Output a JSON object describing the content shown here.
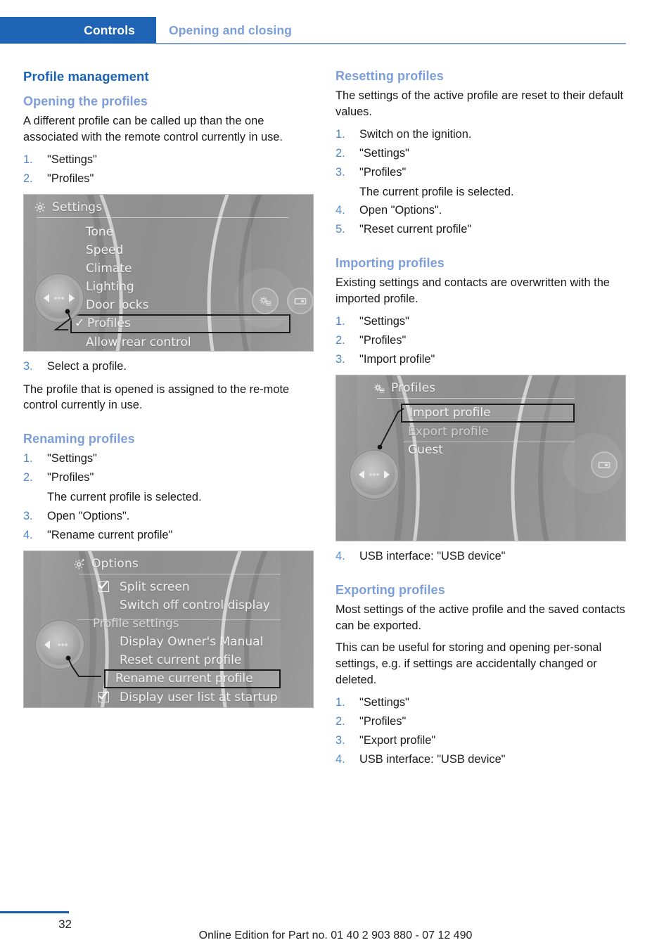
{
  "header": {
    "chapter": "Controls",
    "section": "Opening and closing"
  },
  "left_column": {
    "main_heading": "Profile management",
    "opening": {
      "heading": "Opening the profiles",
      "intro": "A different profile can be called up than the one associated with the remote control currently in use.",
      "steps": [
        {
          "num": "1.",
          "text": "\"Settings\""
        },
        {
          "num": "2.",
          "text": "\"Profiles\""
        }
      ],
      "step3": {
        "num": "3.",
        "text": "Select a profile."
      },
      "outro": "The profile that is opened is assigned to the re-mote control currently in use."
    },
    "renaming": {
      "heading": "Renaming profiles",
      "steps": [
        {
          "num": "1.",
          "text": "\"Settings\"",
          "note": ""
        },
        {
          "num": "2.",
          "text": "\"Profiles\"",
          "note": "The current profile is selected."
        },
        {
          "num": "3.",
          "text": "Open \"Options\".",
          "note": ""
        },
        {
          "num": "4.",
          "text": "\"Rename current profile\"",
          "note": ""
        }
      ]
    }
  },
  "right_column": {
    "resetting": {
      "heading": "Resetting profiles",
      "intro": "The settings of the active profile are reset to their default values.",
      "steps": [
        {
          "num": "1.",
          "text": "Switch on the ignition.",
          "note": ""
        },
        {
          "num": "2.",
          "text": "\"Settings\"",
          "note": ""
        },
        {
          "num": "3.",
          "text": "\"Profiles\"",
          "note": "The current profile is selected."
        },
        {
          "num": "4.",
          "text": "Open \"Options\".",
          "note": ""
        },
        {
          "num": "5.",
          "text": "\"Reset current profile\"",
          "note": ""
        }
      ]
    },
    "importing": {
      "heading": "Importing profiles",
      "intro": "Existing settings and contacts are overwritten with the imported profile.",
      "steps": [
        {
          "num": "1.",
          "text": "\"Settings\""
        },
        {
          "num": "2.",
          "text": "\"Profiles\""
        },
        {
          "num": "3.",
          "text": "\"Import profile\""
        }
      ],
      "step4": {
        "num": "4.",
        "text": "USB interface: \"USB device\""
      }
    },
    "exporting": {
      "heading": "Exporting profiles",
      "intro1": "Most settings of the active profile and the saved contacts can be exported.",
      "intro2": "This can be useful for storing and opening per-sonal settings, e.g. if settings are accidentally changed or deleted.",
      "steps": [
        {
          "num": "1.",
          "text": "\"Settings\""
        },
        {
          "num": "2.",
          "text": "\"Profiles\""
        },
        {
          "num": "3.",
          "text": "\"Export profile\""
        },
        {
          "num": "4.",
          "text": "USB interface: \"USB device\""
        }
      ]
    }
  },
  "screenshots": {
    "settings_menu": {
      "title": "Settings",
      "items": [
        {
          "label": "Tone"
        },
        {
          "label": "Speed"
        },
        {
          "label": "Climate"
        },
        {
          "label": "Lighting"
        },
        {
          "label": "Door locks"
        },
        {
          "label": "Profiles"
        },
        {
          "label": "Allow rear control"
        }
      ],
      "highlighted": "Profiles",
      "checked": "Profiles"
    },
    "options_menu": {
      "title": "Options",
      "items": [
        {
          "label": "Split screen"
        },
        {
          "label": "Switch off control display"
        },
        {
          "label": "Profile settings"
        },
        {
          "label": "Display Owner's Manual"
        },
        {
          "label": "Reset current profile"
        },
        {
          "label": "Rename current profile"
        },
        {
          "label": "Display user list at startup"
        }
      ],
      "highlighted": "Rename current profile",
      "checkboxes": [
        "Split screen",
        "Display user list at startup"
      ]
    },
    "profiles_menu": {
      "title": "Profiles",
      "items": [
        {
          "label": "Import profile"
        },
        {
          "label": "Export profile"
        },
        {
          "label": "Guest"
        }
      ],
      "highlighted": "Import profile"
    }
  },
  "footer": {
    "page_number": "32",
    "edition": "Online Edition for Part no. 01 40 2 903 880 - 07 12 490"
  },
  "colors": {
    "chapter_tab_bg": "#1e63b4",
    "section_blue": "#7c9ed9",
    "heading_blue": "#1a62b3",
    "step_number_blue": "#4d87c9",
    "footer_rule": "#1a5aa6",
    "screen_gray": "#8f8f8f"
  }
}
